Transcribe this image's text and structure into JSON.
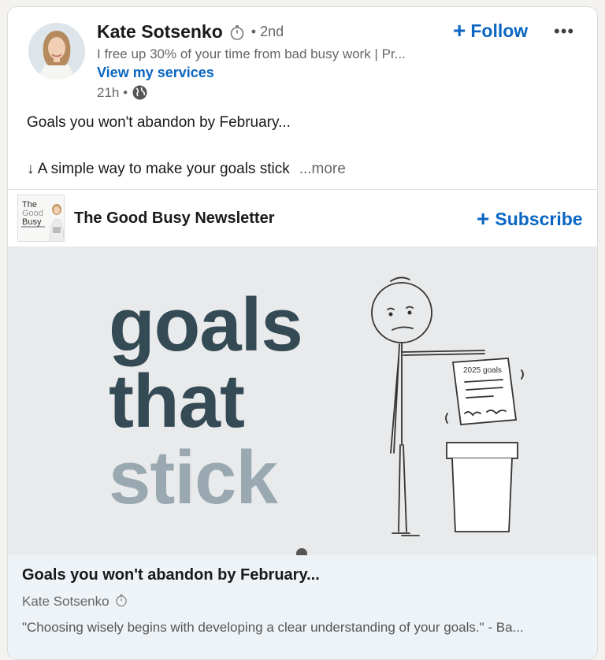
{
  "post": {
    "author_name": "Kate Sotsenko",
    "degree": "• 2nd",
    "headline": "I free up 30% of your time from bad busy work | Pr...",
    "services_link": "View my services",
    "time_ago": "21h •",
    "follow_label": "Follow",
    "more_label": "•••",
    "commentary_line1": "Goals you won't abandon by February...",
    "commentary_line2": "↓ A simple way to make your goals stick",
    "see_more": "...more"
  },
  "newsletter": {
    "logo_text": [
      "The",
      "Good",
      "Busy"
    ],
    "title": "The Good Busy Newsletter",
    "subscribe_label": "Subscribe"
  },
  "article_image": {
    "words": [
      "goals",
      "that",
      "stick"
    ],
    "paper_label": "2025 goals",
    "colors": {
      "dark_word": "#344a55",
      "light_word": "#9aa9b1",
      "background": "#e9eaeb"
    }
  },
  "article": {
    "title": "Goals you won't abandon by February...",
    "author": "Kate Sotsenko",
    "quote": "\"Choosing wisely begins with developing a clear understanding of your goals.\" - Ba..."
  },
  "icons": {
    "stopwatch": "stopwatch-icon",
    "globe": "globe-icon",
    "plus": "plus-icon",
    "more": "more-icon"
  },
  "colors": {
    "accent": "#0a66c2",
    "text": "#191919",
    "muted": "#666666",
    "footer_bg": "#eef3f8"
  }
}
